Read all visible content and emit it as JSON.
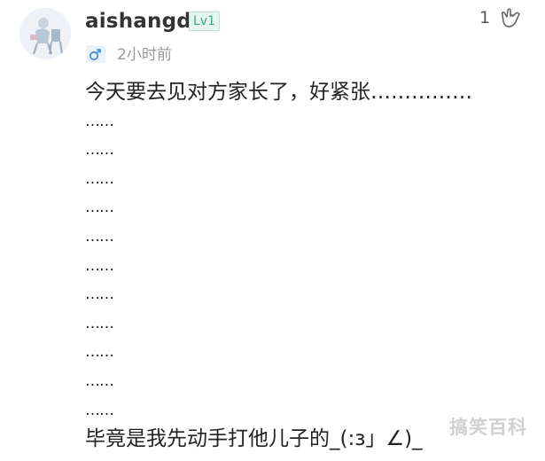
{
  "user": {
    "name": "aishangde",
    "level": "Lv1",
    "time": "2小时前",
    "gender_icon": "male-icon"
  },
  "likes": {
    "count": "1",
    "icon": "shaka-hand-icon"
  },
  "comment": {
    "lines": [
      "今天要去见对方家长了，好紧张……………",
      "……",
      "……",
      "……",
      "……",
      "……",
      "……",
      "……",
      "……",
      "……",
      "……",
      "……",
      "毕竟是我先动手打他儿子的_(:з」∠)_"
    ]
  },
  "watermark": "搞笑百科",
  "colors": {
    "level_text": "#3aa88b",
    "level_bg": "#e6f5ef",
    "gender_blue": "#4a8fe0",
    "time_gray": "#999999"
  }
}
